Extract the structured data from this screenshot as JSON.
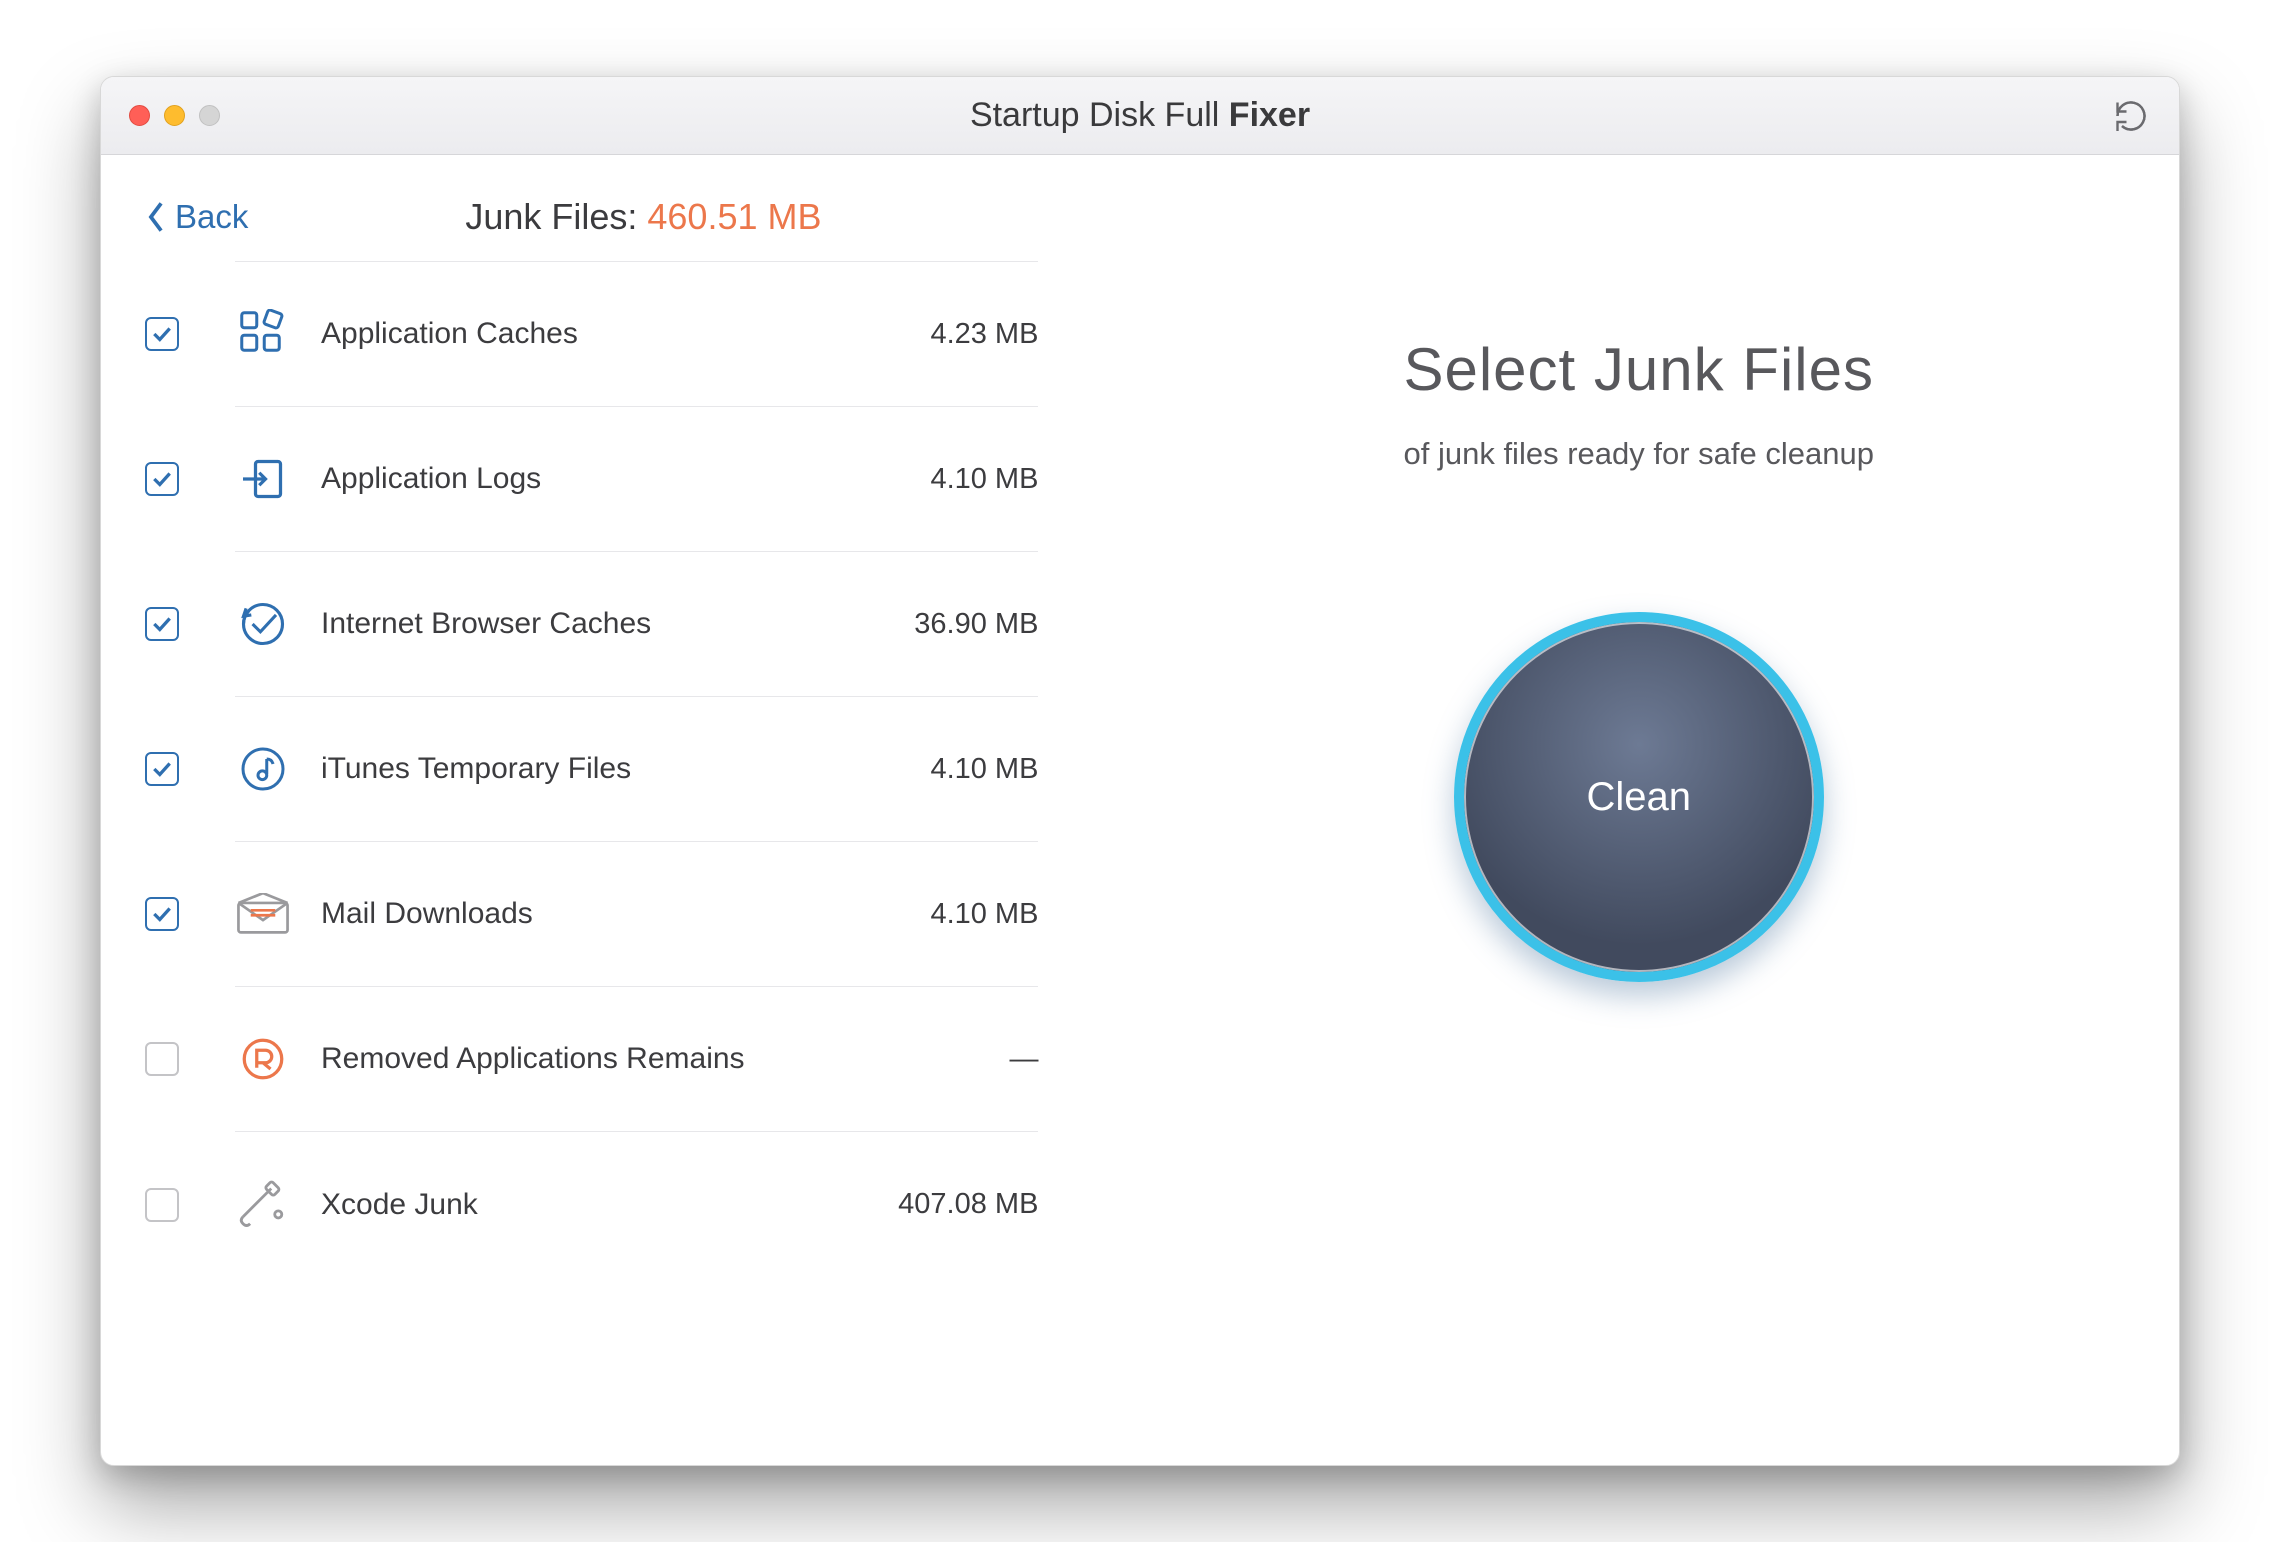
{
  "titlebar": {
    "title_prefix": "Startup Disk Full ",
    "title_bold": "Fixer"
  },
  "left": {
    "back_label": "Back",
    "summary_label": "Junk Files: ",
    "summary_size": "460.51 MB"
  },
  "items": [
    {
      "label": "Application Caches",
      "size": "4.23 MB",
      "checked": true,
      "icon": "apps"
    },
    {
      "label": "Application Logs",
      "size": "4.10 MB",
      "checked": true,
      "icon": "log"
    },
    {
      "label": "Internet Browser Caches",
      "size": "36.90 MB",
      "checked": true,
      "icon": "browser"
    },
    {
      "label": "iTunes Temporary Files",
      "size": "4.10 MB",
      "checked": true,
      "icon": "music"
    },
    {
      "label": "Mail Downloads",
      "size": "4.10 MB",
      "checked": true,
      "icon": "mail"
    },
    {
      "label": "Removed Applications Remains",
      "size": "—",
      "checked": false,
      "icon": "removed"
    },
    {
      "label": "Xcode Junk",
      "size": "407.08 MB",
      "checked": false,
      "icon": "xcode"
    }
  ],
  "right": {
    "title": "Select Junk Files",
    "subtitle": "of junk files ready for safe cleanup",
    "clean_label": "Clean"
  }
}
